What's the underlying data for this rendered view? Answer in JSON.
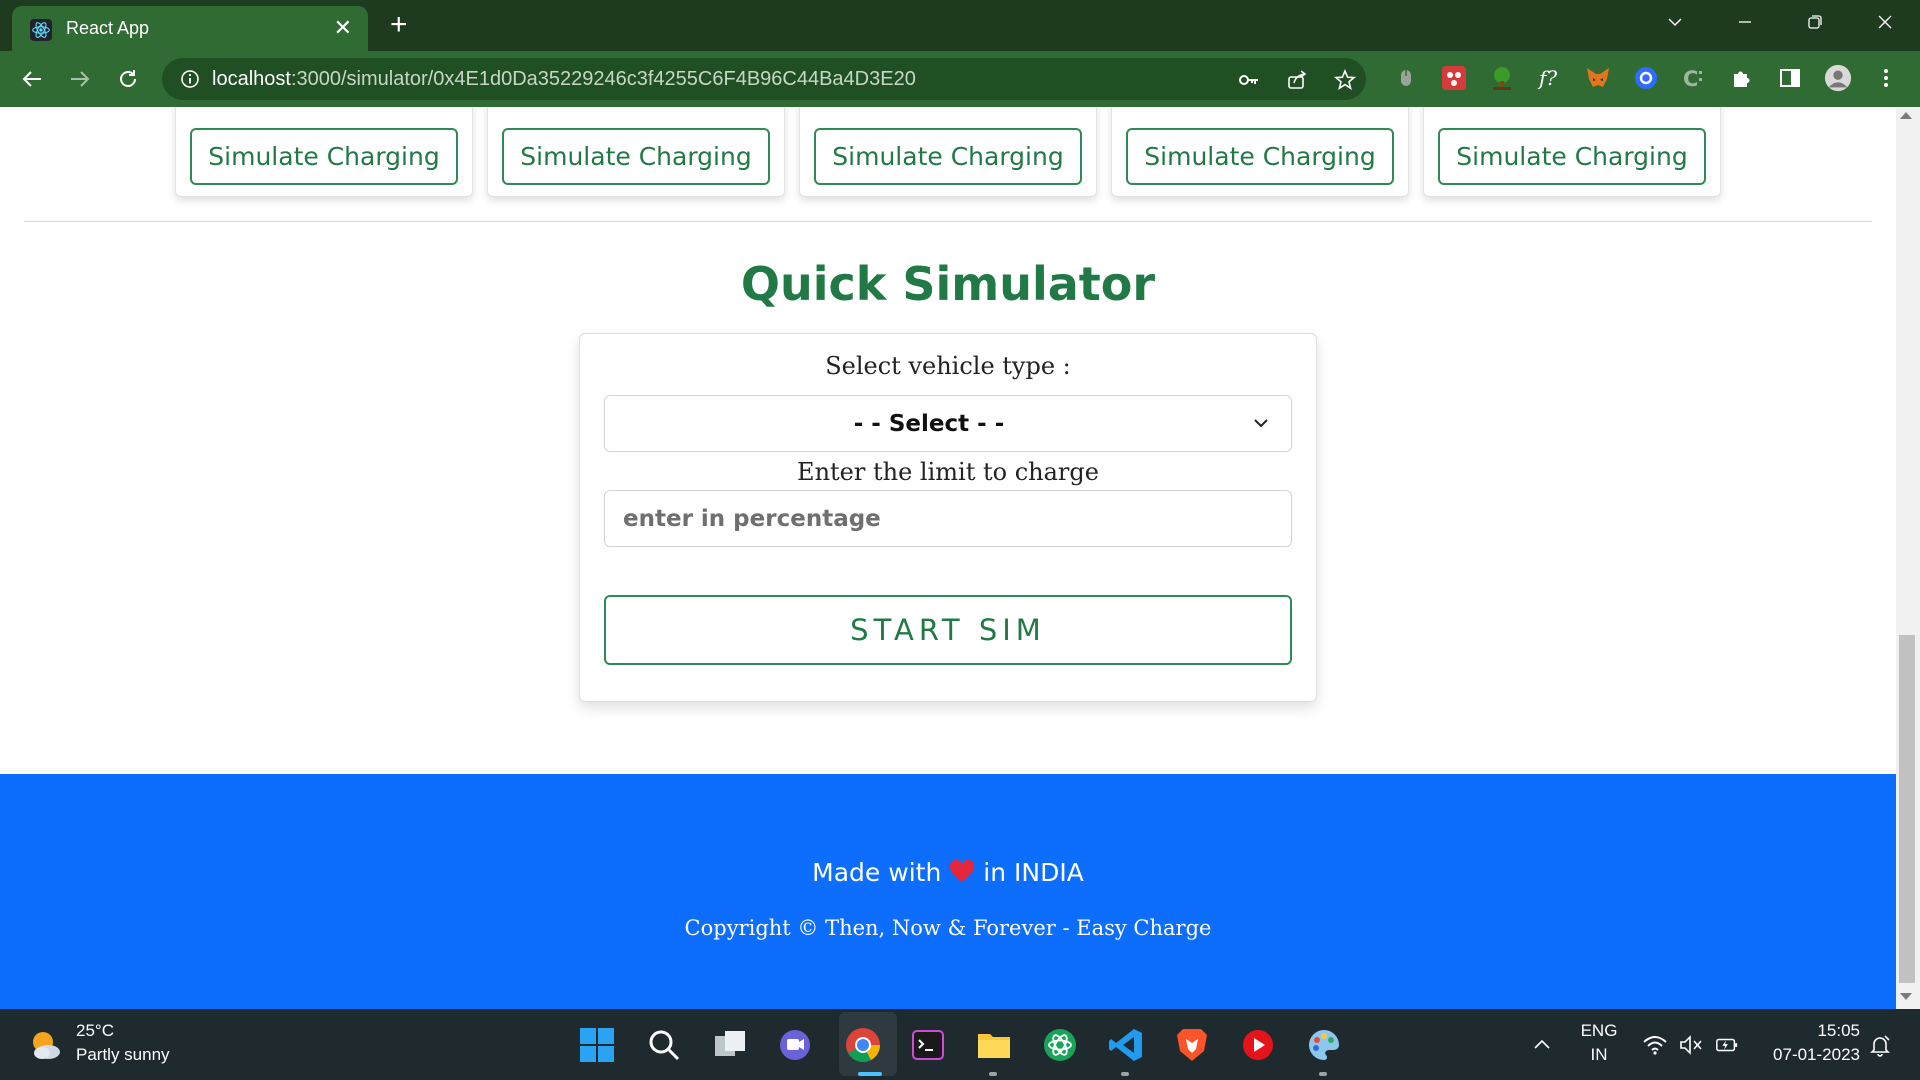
{
  "browser": {
    "tab_title": "React App",
    "tab_close": "✕",
    "new_tab": "+",
    "url_host": "localhost",
    "url_rest": ":3000/simulator/0x4E1d0Da35229246c3f4255C6F4B96C44Ba4D3E20",
    "extensions": [
      "password-key-icon",
      "share-icon",
      "star-icon",
      "extension-1",
      "extension-2",
      "extension-3",
      "extension-f",
      "metamask",
      "extension-5",
      "extension-c",
      "puzzle-icon",
      "sidepanel-icon",
      "profile-avatar"
    ]
  },
  "cards": [
    {
      "label": "Simulate Charging"
    },
    {
      "label": "Simulate Charging"
    },
    {
      "label": "Simulate Charging"
    },
    {
      "label": "Simulate Charging"
    },
    {
      "label": "Simulate Charging"
    }
  ],
  "quick_simulator": {
    "title": "Quick Simulator",
    "vehicle_label": "Select vehicle type :",
    "vehicle_selected": "- - Select - -",
    "limit_label": "Enter the limit to charge",
    "limit_placeholder": "enter in percentage",
    "limit_value": "",
    "start_label": "START SIM"
  },
  "footer": {
    "made_prefix": "Made with",
    "made_suffix": "in INDIA",
    "copyright": "Copyright © Then, Now & Forever - Easy Charge"
  },
  "taskbar": {
    "temperature": "25°C",
    "weather": "Partly sunny",
    "lang_top": "ENG",
    "lang_bottom": "IN",
    "time": "15:05",
    "date": "07-01-2023"
  },
  "colors": {
    "chrome_dark": "#1e3a1f",
    "chrome_tab": "#2f6b33",
    "accent_green": "#217a46",
    "footer_blue": "#0d6efd",
    "taskbar": "#1f2a2f"
  }
}
